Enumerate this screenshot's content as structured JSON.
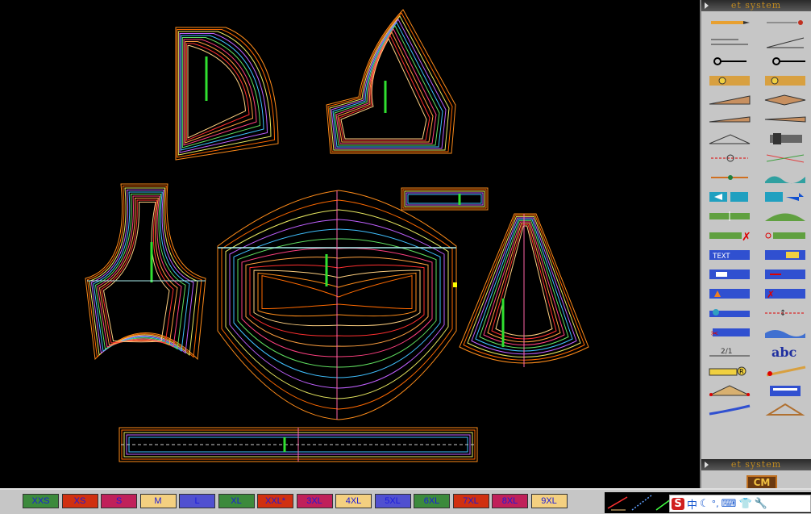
{
  "toolbar": {
    "header_top": "et system",
    "header_bottom": "et system",
    "tools": [
      {
        "name": "pencil-tool-icon"
      },
      {
        "name": "pin-tool-icon"
      },
      {
        "name": "line-tool-icon"
      },
      {
        "name": "angle-line-tool-icon"
      },
      {
        "name": "compass-tool-icon"
      },
      {
        "name": "compass-arc-tool-icon"
      },
      {
        "name": "tape-measure-tool-icon"
      },
      {
        "name": "tape-measure-hook-tool-icon"
      },
      {
        "name": "wedge-tool-icon"
      },
      {
        "name": "dart-tool-icon"
      },
      {
        "name": "slash-tool-icon"
      },
      {
        "name": "needle-tool-icon"
      },
      {
        "name": "fold-tool-icon"
      },
      {
        "name": "sewing-machine-tool-icon"
      },
      {
        "name": "scissors-tool-icon"
      },
      {
        "name": "multi-line-tool-icon"
      },
      {
        "name": "cut-join-tool-icon"
      },
      {
        "name": "wave-piece-tool-icon"
      },
      {
        "name": "move-right-tool-icon"
      },
      {
        "name": "move-arrow-tool-icon"
      },
      {
        "name": "notch-tool-icon"
      },
      {
        "name": "mountain-tool-icon"
      },
      {
        "name": "delete-notch-tool-icon"
      },
      {
        "name": "grain-tool-icon"
      },
      {
        "name": "text-tool-icon",
        "label": "TEXT"
      },
      {
        "name": "piece-highlight-tool-icon"
      },
      {
        "name": "piece-left-tool-icon"
      },
      {
        "name": "piece-arrow-tool-icon"
      },
      {
        "name": "piece-up-tool-icon"
      },
      {
        "name": "piece-delete-tool-icon"
      },
      {
        "name": "hand-tool-icon"
      },
      {
        "name": "measure-split-tool-icon"
      },
      {
        "name": "piece-cut-tool-icon"
      },
      {
        "name": "wave-line-tool-icon"
      },
      {
        "name": "fraction-tool-icon",
        "label": "2/1"
      },
      {
        "name": "abc-tool-icon",
        "label": "abc"
      },
      {
        "name": "ruler-r-tool-icon",
        "label": "R"
      },
      {
        "name": "pen-scale-tool-icon"
      },
      {
        "name": "triangle-ruler-tool-icon"
      },
      {
        "name": "calculator-tool-icon"
      },
      {
        "name": "curve-ruler-tool-icon"
      },
      {
        "name": "set-square-tool-icon"
      }
    ],
    "cm_label": "CM"
  },
  "sizes": [
    {
      "label": "XXS",
      "color": "#3c8a3c",
      "text": "#1a1adc"
    },
    {
      "label": "XS",
      "color": "#d03010",
      "text": "#1a1adc"
    },
    {
      "label": "S",
      "color": "#c0205a",
      "text": "#1a1adc"
    },
    {
      "label": "M",
      "color": "#f4d080",
      "text": "#1a1adc"
    },
    {
      "label": "L",
      "color": "#5050d0",
      "text": "#1a1adc"
    },
    {
      "label": "XL",
      "color": "#3c8a3c",
      "text": "#1a1adc"
    },
    {
      "label": "XXL*",
      "color": "#d03010",
      "text": "#1a1adc"
    },
    {
      "label": "3XL",
      "color": "#c0205a",
      "text": "#1a1adc"
    },
    {
      "label": "4XL",
      "color": "#f4d080",
      "text": "#1a1adc"
    },
    {
      "label": "5XL",
      "color": "#5050d0",
      "text": "#1a1adc"
    },
    {
      "label": "6XL",
      "color": "#3c8a3c",
      "text": "#1a1adc"
    },
    {
      "label": "7XL",
      "color": "#d03010",
      "text": "#1a1adc"
    },
    {
      "label": "8XL",
      "color": "#c0205a",
      "text": "#1a1adc"
    },
    {
      "label": "9XL",
      "color": "#f4d080",
      "text": "#1a1adc"
    }
  ],
  "ime": {
    "logo": "S",
    "mode": "中"
  },
  "grade_colors": [
    "#ff8c1a",
    "#ff6a00",
    "#e8e860",
    "#c060ff",
    "#40c0ff",
    "#60e060",
    "#ff4080",
    "#ffa040",
    "#ff3030",
    "#ffd080"
  ]
}
